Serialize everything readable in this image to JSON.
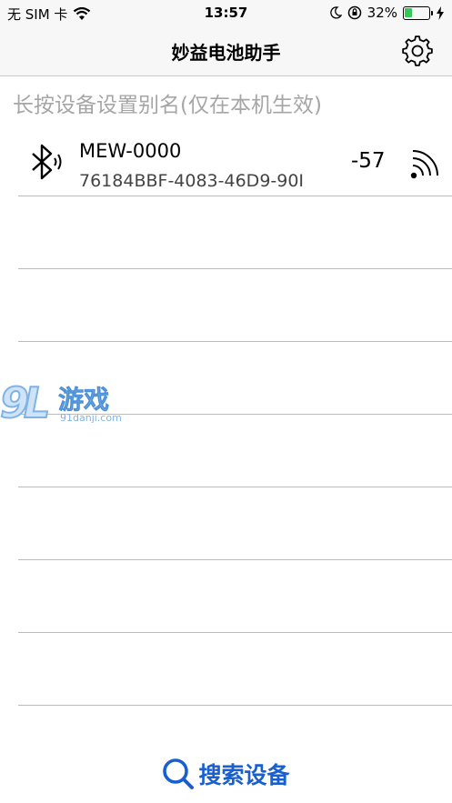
{
  "status_bar": {
    "carrier": "无 SIM 卡",
    "time": "13:57",
    "battery_percent": "32%",
    "battery_level": 0.32,
    "battery_color": "#34c759"
  },
  "nav": {
    "title": "妙益电池助手",
    "settings_icon": "gear-icon"
  },
  "hint": "长按设备设置别名(仅在本机生效)",
  "devices": [
    {
      "name": "MEW-0000",
      "uuid": "76184BBF-4083-46D9-90I",
      "rssi": "-57"
    }
  ],
  "empty_rows": 7,
  "watermark": {
    "brand": "游戏",
    "site": "91danji.com"
  },
  "search_button": {
    "label": "搜索设备",
    "color": "#1a5fd0"
  }
}
